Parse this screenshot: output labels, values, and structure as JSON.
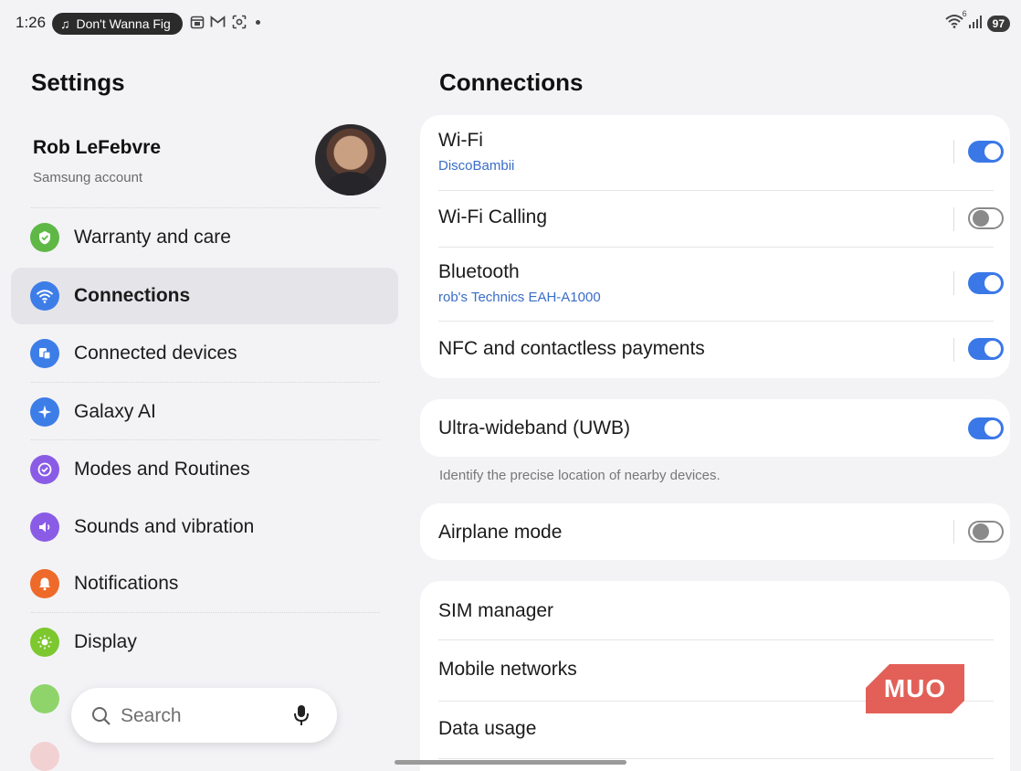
{
  "status_bar": {
    "time": "1:26",
    "media_title": "Don't Wanna Fig",
    "battery": "97",
    "wifi_badge": "6"
  },
  "left_pane": {
    "title": "Settings",
    "profile": {
      "name": "Rob LeFebvre",
      "subtitle": "Samsung account"
    },
    "items": [
      {
        "label": "Warranty and care",
        "icon": "warranty-icon",
        "color": "#5fb846"
      },
      {
        "label": "Connections",
        "icon": "wifi-icon",
        "color": "#3d7de8",
        "selected": true
      },
      {
        "label": "Connected devices",
        "icon": "devices-icon",
        "color": "#3d7de8"
      },
      {
        "label": "Galaxy AI",
        "icon": "sparkle-icon",
        "color": "#3d7de8"
      },
      {
        "label": "Modes and Routines",
        "icon": "check-circle-icon",
        "color": "#8a5ce6"
      },
      {
        "label": "Sounds and vibration",
        "icon": "speaker-icon",
        "color": "#8a5ce6"
      },
      {
        "label": "Notifications",
        "icon": "bell-icon",
        "color": "#ee6a2a"
      },
      {
        "label": "Display",
        "icon": "sun-icon",
        "color": "#7dc72f"
      }
    ],
    "search": {
      "label": "Search"
    }
  },
  "right_pane": {
    "title": "Connections",
    "rows": [
      {
        "title": "Wi-Fi",
        "subtitle": "DiscoBambii",
        "toggle": true
      },
      {
        "title": "Wi-Fi Calling",
        "toggle": false
      },
      {
        "title": "Bluetooth",
        "subtitle": "rob's Technics EAH-A1000",
        "toggle": true
      },
      {
        "title": "NFC and contactless payments",
        "toggle": true
      },
      {
        "title": "Ultra-wideband (UWB)",
        "toggle": true
      },
      {
        "title": "Airplane mode",
        "toggle": false
      },
      {
        "title": "SIM manager"
      },
      {
        "title": "Mobile networks"
      },
      {
        "title": "Data usage"
      }
    ],
    "uwb_hint": "Identify the precise location of nearby devices."
  },
  "watermark": {
    "text": "MUO",
    "color": "#e0524a"
  },
  "colors": {
    "accent": "#3b78e7",
    "background": "#f3f3f6",
    "card": "#ffffff"
  }
}
